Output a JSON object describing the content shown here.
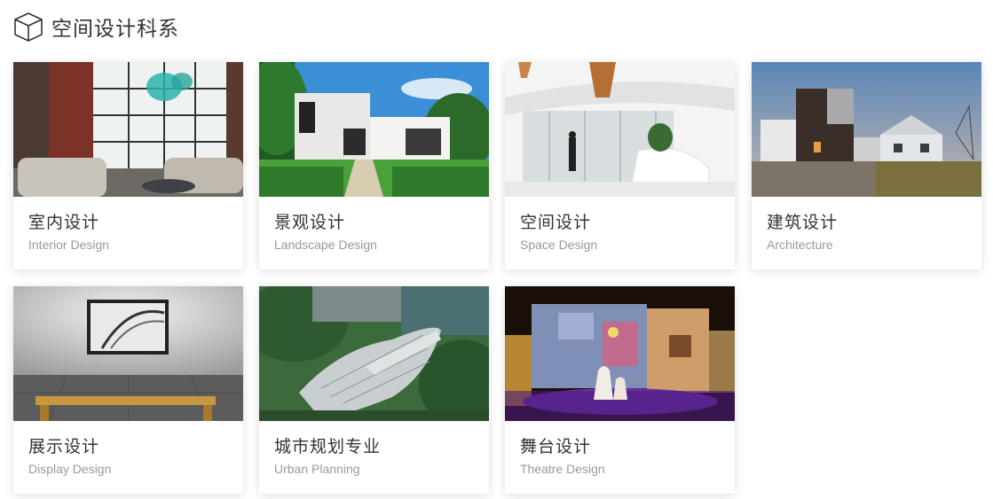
{
  "header": {
    "title": "空间设计科系",
    "icon": "cube-icon"
  },
  "cards": [
    {
      "cn": "室内设计",
      "en": "Interior Design",
      "image": "interior-photo"
    },
    {
      "cn": "景观设计",
      "en": "Landscape Design",
      "image": "landscape-photo"
    },
    {
      "cn": "空间设计",
      "en": "Space Design",
      "image": "space-photo"
    },
    {
      "cn": "建筑设计",
      "en": "Architecture",
      "image": "architecture-photo"
    },
    {
      "cn": "展示设计",
      "en": "Display Design",
      "image": "display-photo"
    },
    {
      "cn": "城市规划专业",
      "en": "Urban Planning",
      "image": "urban-photo"
    },
    {
      "cn": "舞台设计",
      "en": "Theatre Design",
      "image": "theatre-photo"
    }
  ]
}
